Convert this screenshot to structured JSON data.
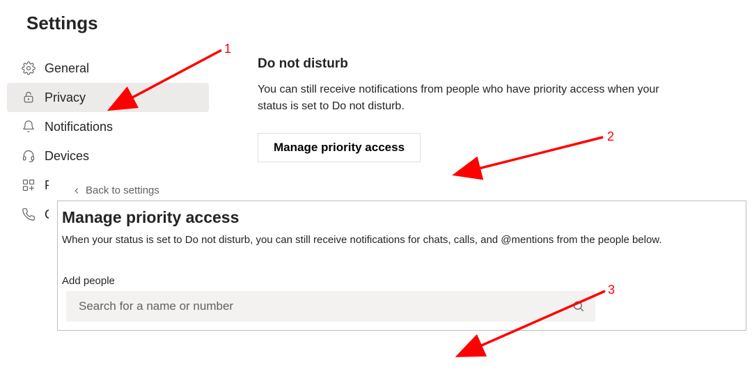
{
  "title": "Settings",
  "sidebar": {
    "items": [
      {
        "label": "General",
        "icon": "gear"
      },
      {
        "label": "Privacy",
        "icon": "lock",
        "selected": true
      },
      {
        "label": "Notifications",
        "icon": "bell"
      },
      {
        "label": "Devices",
        "icon": "headset"
      },
      {
        "label": "Pe",
        "icon": "apps",
        "truncated": true
      },
      {
        "label": "Ca",
        "icon": "phone",
        "truncated": true
      }
    ]
  },
  "dnd": {
    "title": "Do not disturb",
    "desc": "You can still receive notifications from people who have priority access when your status is set to Do not disturb.",
    "button": "Manage priority access"
  },
  "panel": {
    "back": "Back to settings",
    "title": "Manage priority access",
    "desc": "When your status is set to Do not disturb, you can still receive notifications for chats, calls, and @mentions from the people below.",
    "add_label": "Add people",
    "search_placeholder": "Search for a name or number"
  },
  "annotations": {
    "n1": "1",
    "n2": "2",
    "n3": "3"
  }
}
